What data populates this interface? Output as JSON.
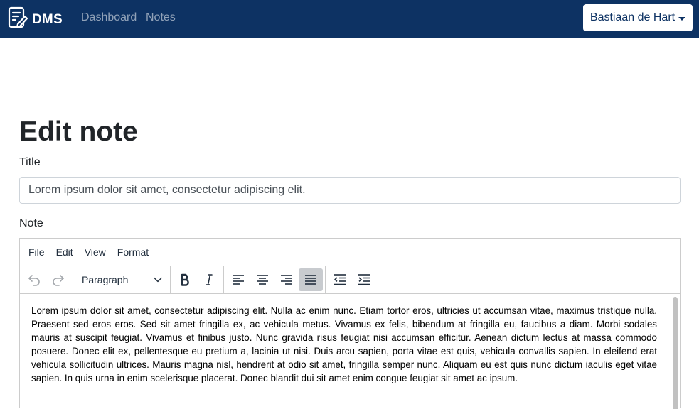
{
  "navbar": {
    "brand": "DMS",
    "links": [
      "Dashboard",
      "Notes"
    ],
    "user": "Bastiaan de Hart"
  },
  "page": {
    "heading": "Edit note",
    "title_label": "Title",
    "title_value": "Lorem ipsum dolor sit amet, consectetur adipiscing elit.",
    "note_label": "Note"
  },
  "editor": {
    "menu": [
      "File",
      "Edit",
      "View",
      "Format"
    ],
    "block_format": "Paragraph",
    "content": "Lorem ipsum dolor sit amet, consectetur adipiscing elit. Nulla ac enim nunc. Etiam tortor eros, ultricies ut accumsan vitae, maximus tristique nulla. Praesent sed eros eros. Sed sit amet fringilla ex, ac vehicula metus. Vivamus ex felis, bibendum at fringilla eu, faucibus a diam. Morbi sodales mauris at suscipit feugiat. Vivamus et finibus justo. Nunc gravida risus feugiat nisi accumsan efficitur. Aenean dictum lectus at massa commodo posuere. Donec elit ex, pellentesque eu pretium a, lacinia ut nisi. Duis arcu sapien, porta vitae est quis, vehicula convallis sapien. In eleifend erat vehicula sollicitudin ultrices. Mauris magna nisl, hendrerit at odio sit amet, fringilla semper nunc. Aliquam eu est quis nunc dictum iaculis eget vitae sapien. In quis urna in enim scelerisque placerat. Donec blandit dui sit amet enim congue feugiat sit amet ac ipsum."
  },
  "colors": {
    "navbar_bg": "#0d3263",
    "active_button_bg": "#c8cbcf"
  },
  "icons": [
    "notes-logo-icon",
    "undo-icon",
    "redo-icon",
    "chevron-down-icon",
    "bold-icon",
    "italic-icon",
    "align-left-icon",
    "align-center-icon",
    "align-right-icon",
    "align-justify-icon",
    "outdent-icon",
    "indent-icon",
    "caret-down-icon"
  ]
}
